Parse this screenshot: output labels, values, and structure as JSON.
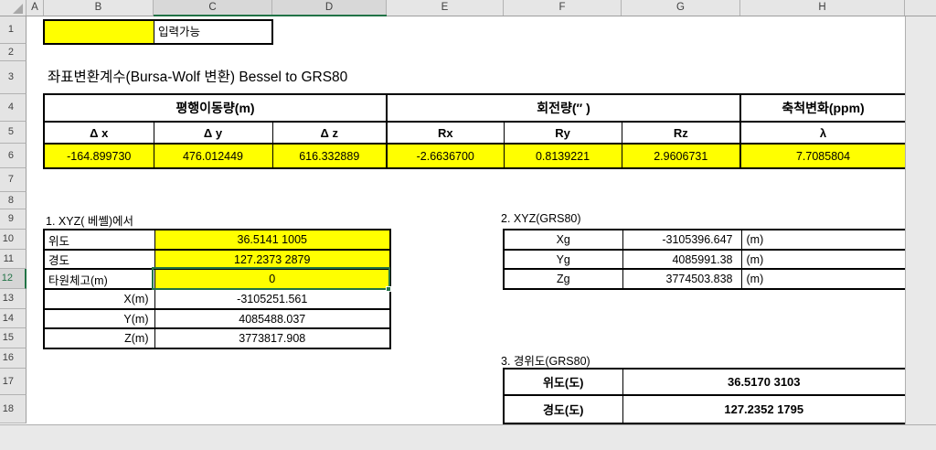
{
  "spreadsheet": {
    "column_headers": [
      "A",
      "B",
      "C",
      "D",
      "E",
      "F",
      "G",
      "H"
    ],
    "row_headers": [
      "1",
      "2",
      "3",
      "4",
      "5",
      "6",
      "7",
      "8",
      "9",
      "10",
      "11",
      "12",
      "13",
      "14",
      "15",
      "16",
      "17",
      "18"
    ],
    "selected_columns": "C:D",
    "selected_row": "12",
    "active_cell_value": "0"
  },
  "legend": {
    "label": "입력가능"
  },
  "title": "좌표변환계수(Bursa-Wolf 변환) Bessel to GRS80",
  "params_table": {
    "group_headers": [
      "평행이동량(m)",
      "회전량(″ )",
      "축척변화(ppm)"
    ],
    "col_headers": [
      "Δ x",
      "Δ y",
      "Δ z",
      "Rx",
      "Ry",
      "Rz",
      "λ"
    ],
    "values": [
      "-164.899730",
      "476.012449",
      "616.332889",
      "-2.6636700",
      "0.8139221",
      "2.9606731",
      "7.7085804"
    ]
  },
  "section1": {
    "title": "1. XYZ( 베쎌)에서",
    "rows": [
      {
        "label": "위도",
        "value": "36.5141 1005"
      },
      {
        "label": "경도",
        "value": "127.2373 2879"
      },
      {
        "label": "타원체고(m)",
        "value": "0"
      },
      {
        "label": "X(m)",
        "value": "-3105251.561"
      },
      {
        "label": "Y(m)",
        "value": "4085488.037"
      },
      {
        "label": "Z(m)",
        "value": "3773817.908"
      }
    ]
  },
  "section2": {
    "title": "2. XYZ(GRS80)",
    "rows": [
      {
        "label": "Xg",
        "value": "-3105396.647",
        "unit": "(m)"
      },
      {
        "label": "Yg",
        "value": "4085991.38",
        "unit": "(m)"
      },
      {
        "label": "Zg",
        "value": "3774503.838",
        "unit": "(m)"
      }
    ]
  },
  "section3": {
    "title": "3. 경위도(GRS80)",
    "rows": [
      {
        "label": "위도(도)",
        "value": "36.5170 3103"
      },
      {
        "label": "경도(도)",
        "value": "127.2352 1795"
      }
    ]
  },
  "colors": {
    "highlight_yellow": "#ffff00",
    "selection_green": "#217346",
    "header_gray": "#e6e6e6"
  }
}
